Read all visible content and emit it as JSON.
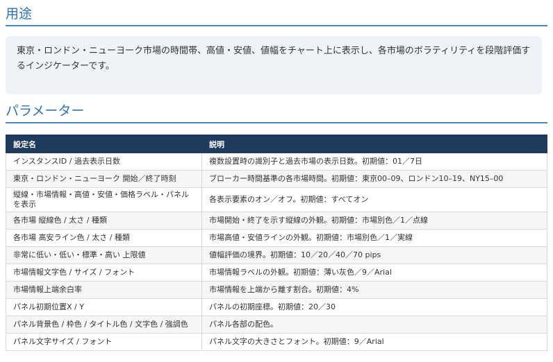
{
  "purpose": {
    "heading": "用途",
    "text": "東京・ロンドン・ニューヨーク市場の時間帯、高値・安値、値幅をチャート上に表示し、各市場のボラティリティを段階評価するインジケーターです。"
  },
  "parameters": {
    "heading": "パラメーター",
    "columns": [
      "設定名",
      "説明"
    ],
    "rows": [
      [
        "インスタンスID / 過去表示日数",
        "複数設置時の識別子と過去市場の表示日数。初期値：01／7日"
      ],
      [
        "東京・ロンドン・ニューヨーク 開始／終了時刻",
        "ブローカー時間基準の各市場時間。初期値：東京00–09、ロンドン10–19、NY15–00"
      ],
      [
        "縦線・市場情報・高値・安値・価格ラベル・パネルを表示",
        "各表示要素のオン／オフ。初期値：すべてオン"
      ],
      [
        "各市場 縦線色 / 太さ / 種類",
        "市場開始・終了を示す縦線の外観。初期値：市場別色／1／点線"
      ],
      [
        "各市場 高安ライン色 / 太さ / 種類",
        "市場高値・安値ラインの外観。初期値：市場別色／1／実線"
      ],
      [
        "非常に低い・低い・標準・高い 上限値",
        "値幅評価の境界。初期値：10／20／40／70 pips"
      ],
      [
        "市場情報文字色 / サイズ / フォント",
        "市場情報ラベルの外観。初期値：薄い灰色／9／Arial"
      ],
      [
        "市場情報上端余白率",
        "市場情報を上端から離す割合。初期値：4%"
      ],
      [
        "パネル初期位置X / Y",
        "パネルの初期座標。初期値：20／30"
      ],
      [
        "パネル背景色 / 枠色 / タイトル色 / 文字色 / 強調色",
        "パネル各部の配色。"
      ],
      [
        "パネル文字サイズ / フォント",
        "パネル文字の大きさとフォント。初期値：9／Arial"
      ]
    ]
  }
}
